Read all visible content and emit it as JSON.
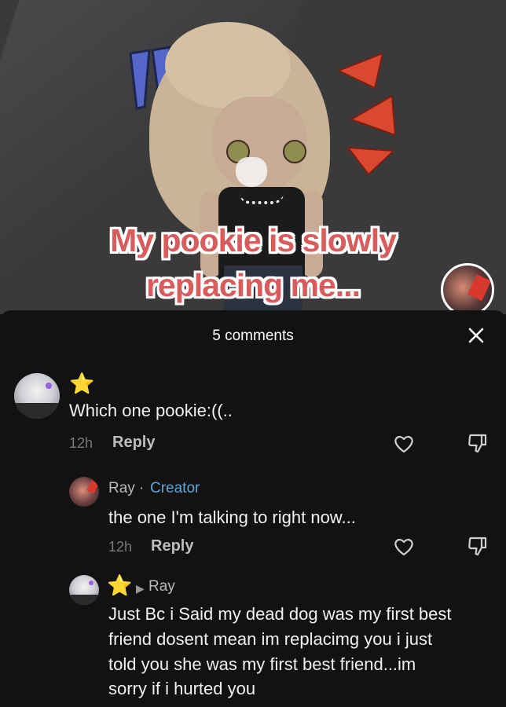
{
  "video": {
    "caption_line1": "My pookie is slowly",
    "caption_line2": "replacing me..."
  },
  "comments_sheet": {
    "title": "5 comments",
    "close_icon": "close-icon"
  },
  "comments": [
    {
      "author_badge": "⭐",
      "text": "Which one pookie:((..",
      "time": "12h",
      "reply_label": "Reply"
    },
    {
      "author": "Ray",
      "separator": "·",
      "creator_label": "Creator",
      "text": "the one I'm talking to right now...",
      "time": "12h",
      "reply_label": "Reply"
    },
    {
      "author_badge": "⭐",
      "reply_to": "Ray",
      "text_lines": [
        "Just Bc i Said my dead dog was my first best",
        "friend dosent mean im replacimg you i just",
        "told you she was my first best friend...im",
        "sorry if i hurted you"
      ]
    }
  ],
  "colors": {
    "sheet_bg": "#121212",
    "creator_accent": "#5aa7d8",
    "caption_red": "#d85c5c"
  },
  "icons": [
    "heart-icon",
    "dislike-icon",
    "close-icon",
    "star-icon",
    "caret-right-icon"
  ]
}
